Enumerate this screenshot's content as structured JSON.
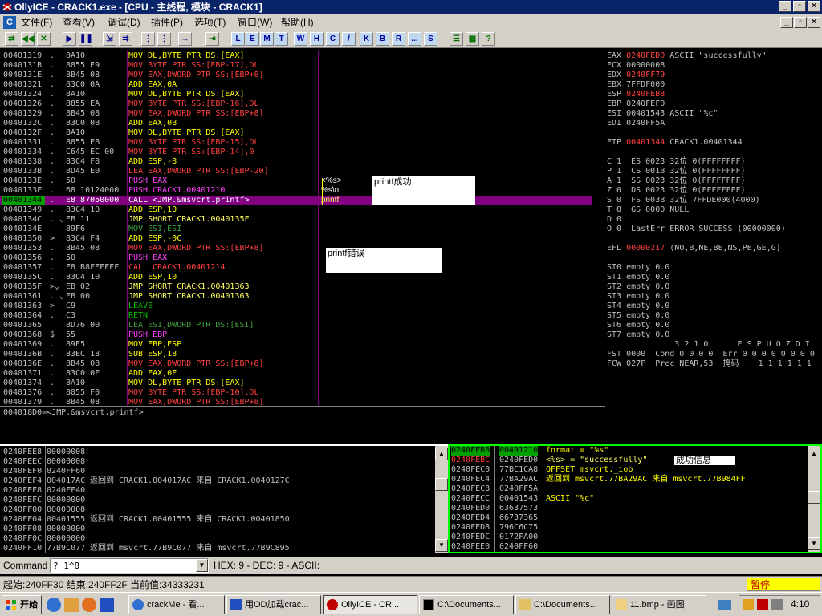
{
  "window": {
    "title": "OllyICE - CRACK1.exe - [CPU - 主线程, 模块 - CRACK1]"
  },
  "menu": [
    "文件(F)",
    "查看(V)",
    "调试(D)",
    "插件(P)",
    "选项(T)",
    "窗口(W)",
    "帮助(H)"
  ],
  "toolbar_letters": [
    "L",
    "E",
    "M",
    "T",
    "W",
    "H",
    "C",
    "/",
    "K",
    "B",
    "R",
    "...",
    "S"
  ],
  "disasm": [
    {
      "addr": "00401319",
      "mark": ".",
      "hex": "8A10",
      "asm": "MOV DL,BYTE PTR DS:[EAX]",
      "c": "cy"
    },
    {
      "addr": "0040131B",
      "mark": ".",
      "hex": "8855 E9",
      "asm": "MOV BYTE PTR SS:[EBP-17],DL",
      "c": "cr"
    },
    {
      "addr": "0040131E",
      "mark": ".",
      "hex": "8B45 08",
      "asm": "MOV EAX,DWORD PTR SS:[EBP+8]",
      "c": "cr"
    },
    {
      "addr": "00401321",
      "mark": ".",
      "hex": "83C0 0A",
      "asm": "ADD EAX,0A",
      "c": "cy"
    },
    {
      "addr": "00401324",
      "mark": ".",
      "hex": "8A10",
      "asm": "MOV DL,BYTE PTR DS:[EAX]",
      "c": "cy"
    },
    {
      "addr": "00401326",
      "mark": ".",
      "hex": "8855 EA",
      "asm": "MOV BYTE PTR SS:[EBP-16],DL",
      "c": "cr"
    },
    {
      "addr": "00401329",
      "mark": ".",
      "hex": "8B45 08",
      "asm": "MOV EAX,DWORD PTR SS:[EBP+8]",
      "c": "cr"
    },
    {
      "addr": "0040132C",
      "mark": ".",
      "hex": "83C0 0B",
      "asm": "ADD EAX,0B",
      "c": "cy"
    },
    {
      "addr": "0040132F",
      "mark": ".",
      "hex": "8A10",
      "asm": "MOV DL,BYTE PTR DS:[EAX]",
      "c": "cy"
    },
    {
      "addr": "00401331",
      "mark": ".",
      "hex": "8855 EB",
      "asm": "MOV BYTE PTR SS:[EBP-15],DL",
      "c": "cr"
    },
    {
      "addr": "00401334",
      "mark": ".",
      "hex": "C645 EC 00",
      "asm": "MOV BYTE PTR SS:[EBP-14],0",
      "c": "cr"
    },
    {
      "addr": "00401338",
      "mark": ".",
      "hex": "83C4 F8",
      "asm": "ADD ESP,-8",
      "c": "cy"
    },
    {
      "addr": "0040133B",
      "mark": ".",
      "hex": "8D45 E0",
      "asm": "LEA EAX,DWORD PTR SS:[EBP-20]",
      "c": "cr"
    },
    {
      "addr": "0040133E",
      "mark": ".",
      "hex": "50",
      "asm": "PUSH EAX",
      "c": "cm"
    },
    {
      "addr": "0040133F",
      "mark": ".",
      "hex": "68 10124000",
      "asm": "PUSH CRACK1.00401210",
      "c": "cm"
    },
    {
      "addr": "00401344",
      "mark": ".",
      "hex": "E8 87050000",
      "asm": "CALL <JMP.&msvcrt.printf>",
      "c": "cw",
      "sel": true
    },
    {
      "addr": "00401349",
      "mark": ".",
      "hex": "83C4 10",
      "asm": "ADD ESP,10",
      "c": "cy"
    },
    {
      "addr": "0040134C",
      "mark": ". ⌄",
      "hex": "EB 11",
      "asm": "JMP SHORT CRACK1.0040135F",
      "c": "cyl"
    },
    {
      "addr": "0040134E",
      "mark": "",
      "hex": "89F6",
      "asm": "MOV ESI,ESI",
      "c": "cgr"
    },
    {
      "addr": "00401350",
      "mark": ">",
      "hex": "83C4 F4",
      "asm": "ADD ESP,-0C",
      "c": "cy"
    },
    {
      "addr": "00401353",
      "mark": ".",
      "hex": "8B45 08",
      "asm": "MOV EAX,DWORD PTR SS:[EBP+8]",
      "c": "cr"
    },
    {
      "addr": "00401356",
      "mark": ".",
      "hex": "50",
      "asm": "PUSH EAX",
      "c": "cm"
    },
    {
      "addr": "00401357",
      "mark": ".",
      "hex": "E8 B8FEFFFF",
      "asm": "CALL CRACK1.00401214",
      "c": "cr"
    },
    {
      "addr": "0040135C",
      "mark": ".",
      "hex": "83C4 10",
      "asm": "ADD ESP,10",
      "c": "cy"
    },
    {
      "addr": "0040135F",
      "mark": ">⌄",
      "hex": "EB 02",
      "asm": "JMP SHORT CRACK1.00401363",
      "c": "cyl"
    },
    {
      "addr": "00401361",
      "mark": ". ⌄",
      "hex": "EB 00",
      "asm": "JMP SHORT CRACK1.00401363",
      "c": "cyl"
    },
    {
      "addr": "00401363",
      "mark": ">",
      "hex": "C9",
      "asm": "LEAVE",
      "c": "cg"
    },
    {
      "addr": "00401364",
      "mark": ".",
      "hex": "C3",
      "asm": "RETN",
      "c": "cg"
    },
    {
      "addr": "00401365",
      "mark": "",
      "hex": "8D76 00",
      "asm": "LEA ESI,DWORD PTR DS:[ESI]",
      "c": "cgr"
    },
    {
      "addr": "00401368",
      "mark": "$",
      "hex": "55",
      "asm": "PUSH EBP",
      "c": "cm"
    },
    {
      "addr": "00401369",
      "mark": ".",
      "hex": "89E5",
      "asm": "MOV EBP,ESP",
      "c": "cy"
    },
    {
      "addr": "0040136B",
      "mark": ".",
      "hex": "83EC 18",
      "asm": "SUB ESP,18",
      "c": "cy"
    },
    {
      "addr": "0040136E",
      "mark": ".",
      "hex": "8B45 08",
      "asm": "MOV EAX,DWORD PTR SS:[EBP+8]",
      "c": "cr"
    },
    {
      "addr": "00401371",
      "mark": ".",
      "hex": "83C0 0F",
      "asm": "ADD EAX,0F",
      "c": "cy"
    },
    {
      "addr": "00401374",
      "mark": ".",
      "hex": "8A10",
      "asm": "MOV DL,BYTE PTR DS:[EAX]",
      "c": "cy"
    },
    {
      "addr": "00401376",
      "mark": ".",
      "hex": "8855 F0",
      "asm": "MOV BYTE PTR SS:[EBP-10],DL",
      "c": "cr"
    },
    {
      "addr": "00401379",
      "mark": ".",
      "hex": "8B45 08",
      "asm": "MOV EAX,DWORD PTR SS:[EBP+8]",
      "c": "cr"
    }
  ],
  "disasm_comments": {
    "c1": "<%s>",
    "c2": "%s\\n",
    "c3": "printf"
  },
  "notes": {
    "success": "printf成功",
    "error": "printf错误",
    "stack_note": "成功信息"
  },
  "registers": [
    {
      "t": "EAX 0240FED0 ASCII \"successfully\"",
      "c": [
        "cr",
        4,
        12
      ]
    },
    {
      "t": "ECX 00000008"
    },
    {
      "t": "EDX 0240FF79",
      "c": [
        "cr",
        4,
        12
      ]
    },
    {
      "t": "EBX 7FFDF000"
    },
    {
      "t": "ESP 0240FEB8",
      "c": [
        "cr",
        4,
        12
      ]
    },
    {
      "t": "EBP 0240FEF0"
    },
    {
      "t": "ESI 00401543 ASCII \"%c\""
    },
    {
      "t": "EDI 0240FF5A"
    },
    {
      "t": ""
    },
    {
      "t": "EIP 00401344 CRACK1.00401344",
      "c": [
        "cr",
        4,
        12
      ]
    },
    {
      "t": ""
    },
    {
      "t": "C 1  ES 0023 32位 0(FFFFFFFF)"
    },
    {
      "t": "P 1  CS 001B 32位 0(FFFFFFFF)"
    },
    {
      "t": "A 1  SS 0023 32位 0(FFFFFFFF)"
    },
    {
      "t": "Z 0  DS 0023 32位 0(FFFFFFFF)"
    },
    {
      "t": "S 0  FS 003B 32位 7FFDE000(4000)"
    },
    {
      "t": "T 0  GS 0000 NULL"
    },
    {
      "t": "D 0"
    },
    {
      "t": "O 0  LastErr ERROR_SUCCESS (00000000)"
    },
    {
      "t": ""
    },
    {
      "t": "EFL 00000217 (NO,B,NE,BE,NS,PE,GE,G)",
      "c": [
        "cr",
        4,
        12
      ]
    },
    {
      "t": ""
    },
    {
      "t": "ST0 empty 0.0"
    },
    {
      "t": "ST1 empty 0.0"
    },
    {
      "t": "ST2 empty 0.0"
    },
    {
      "t": "ST3 empty 0.0"
    },
    {
      "t": "ST4 empty 0.0"
    },
    {
      "t": "ST5 empty 0.0"
    },
    {
      "t": "ST6 empty 0.0"
    },
    {
      "t": "ST7 empty 0.0"
    },
    {
      "t": "              3 2 1 0      E S P U O Z D I"
    },
    {
      "t": "FST 0000  Cond 0 0 0 0  Err 0 0 0 0 0 0 0 0"
    },
    {
      "t": "FCW 027F  Prec NEAR,53  掩码    1 1 1 1 1 1"
    }
  ],
  "info_line": "004018D0=<JMP.&msvcrt.printf>",
  "dump": [
    [
      "0240FEE8",
      "00000008",
      ""
    ],
    [
      "0240FEEC",
      "00000008",
      ""
    ],
    [
      "0240FEF0",
      "0240FF60",
      ""
    ],
    [
      "0240FEF4",
      "004017AC",
      "返回到 CRACK1.004017AC 来自 CRACK1.0040127C"
    ],
    [
      "0240FEF8",
      "0240FF40",
      ""
    ],
    [
      "0240FEFC",
      "00000000",
      ""
    ],
    [
      "0240FF00",
      "00000008",
      ""
    ],
    [
      "0240FF04",
      "00401555",
      "返回到 CRACK1.00401555 来自 CRACK1.00401850"
    ],
    [
      "0240FF08",
      "00000000",
      ""
    ],
    [
      "0240FF0C",
      "00000000",
      ""
    ],
    [
      "0240FF10",
      "77B9C077",
      "返回到 msvcrt.77B9C077 来自 msvcrt.77B9C895"
    ]
  ],
  "stack": [
    [
      "0240FEB8",
      "00401210",
      "format = \"%s\""
    ],
    [
      "0240FEBC",
      "0240FED0",
      "<%s> = \"successfully\""
    ],
    [
      "0240FEC0",
      "77BC1CA8",
      "OFFSET msvcrt._iob"
    ],
    [
      "0240FEC4",
      "77BA29AC",
      "返回到 msvcrt.77BA29AC 来自 msvcrt.77B984FF"
    ],
    [
      "0240FEC8",
      "0240FF5A",
      ""
    ],
    [
      "0240FECC",
      "00401543",
      "ASCII \"%c\""
    ],
    [
      "0240FED0",
      "63637573",
      ""
    ],
    [
      "0240FED4",
      "66737365",
      ""
    ],
    [
      "0240FED8",
      "796C6C75",
      ""
    ],
    [
      "0240FEDC",
      "0172FA00",
      ""
    ],
    [
      "0240FEE0",
      "0240FF60",
      ""
    ]
  ],
  "command": {
    "label": "Command :",
    "value": "? 1^8",
    "result": "HEX: 9 - DEC: 9 - ASCII:"
  },
  "status": {
    "text": "起始:240FF30 结束:240FF2F 当前值:34333231",
    "state": "暂停"
  },
  "taskbar": {
    "start": "开始",
    "tasks": [
      "crackMe - 看...",
      "用OD加载crac...",
      "OllyICE - CR...",
      "C:\\Documents...",
      "C:\\Documents...",
      "11.bmp - 画图"
    ],
    "clock": "4:10"
  }
}
